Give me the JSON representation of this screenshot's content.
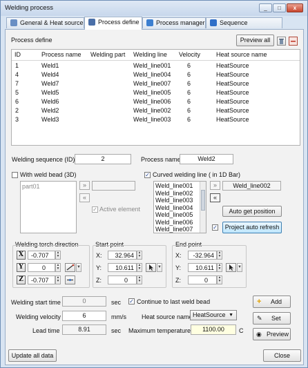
{
  "window": {
    "title": "Welding process",
    "controls": [
      "_",
      "□",
      "x"
    ]
  },
  "tabs": [
    {
      "label": "General & Heat source",
      "active": false
    },
    {
      "label": "Process define",
      "active": true
    },
    {
      "label": "Process manager",
      "active": false
    },
    {
      "label": "Sequence optimization",
      "active": false
    }
  ],
  "process_define": {
    "section_label": "Process define",
    "preview_all_label": "Preview all",
    "delete_icon": "trash-icon",
    "remove_icon": "minus-icon",
    "columns": [
      "ID",
      "Process name",
      "Welding part",
      "Welding line",
      "Velocity",
      "Heat source name"
    ],
    "rows": [
      [
        "1",
        "Weld1",
        "",
        "Weld_line001",
        "6",
        "HeatSource"
      ],
      [
        "4",
        "Weld4",
        "",
        "Weld_line004",
        "6",
        "HeatSource"
      ],
      [
        "7",
        "Weld7",
        "",
        "Weld_line007",
        "6",
        "HeatSource"
      ],
      [
        "5",
        "Weld5",
        "",
        "Weld_line005",
        "6",
        "HeatSource"
      ],
      [
        "6",
        "Weld6",
        "",
        "Weld_line006",
        "6",
        "HeatSource"
      ],
      [
        "2",
        "Weld2",
        "",
        "Weld_line002",
        "6",
        "HeatSource"
      ],
      [
        "3",
        "Weld3",
        "",
        "Weld_line003",
        "6",
        "HeatSource"
      ]
    ]
  },
  "sequence": {
    "seq_label": "Welding sequence (ID):",
    "seq_value": "2",
    "name_label": "Process name:",
    "name_value": "Weld2"
  },
  "weld_bead": {
    "checkbox_label": "With weld bead (3D)",
    "checked": false,
    "parts": [
      "part01"
    ],
    "add_arrow": "»",
    "remove_arrow": "«",
    "active_label": "Active element",
    "active_checked": true
  },
  "curved_line": {
    "checkbox_label": "Curved welding line ( in 1D Bar)",
    "checked": true,
    "lines": [
      "Weld_line001",
      "Weld_line002",
      "Weld_line003",
      "Weld_line004",
      "Weld_line005",
      "Weld_line006",
      "Weld_line007"
    ],
    "add_arrow": "»",
    "remove_arrow": "«",
    "selected_line": "Weld_line002",
    "auto_get_label": "Auto get position",
    "project_refresh_label": "Project auto refresh",
    "project_refresh_checked": true
  },
  "torch": {
    "title": "Welding torch direction",
    "x_label": "X",
    "x": "-0.707",
    "y_label": "Y",
    "y": "0",
    "z_label": "Z",
    "z": "-0.707"
  },
  "start_point": {
    "title": "Start point",
    "x_label": "X:",
    "x": "32.964",
    "y_label": "Y:",
    "y": "10.611",
    "z_label": "Z:",
    "z": "0"
  },
  "end_point": {
    "title": "End point",
    "x_label": "X:",
    "x": "-32.964",
    "y_label": "Y:",
    "y": "10.611",
    "z_label": "Z:",
    "z": "0"
  },
  "params": {
    "start_time_label": "Welding start time",
    "start_time": "0",
    "start_time_unit": "sec",
    "continue_label": "Continue to last weld bead",
    "continue_checked": true,
    "velocity_label": "Welding velocity",
    "velocity": "6",
    "velocity_unit": "mm/s",
    "heat_source_label": "Heat source name",
    "heat_source": "HeatSource",
    "lead_time_label": "Lead time",
    "lead_time": "8.91",
    "lead_time_unit": "sec",
    "max_temp_label": "Maximum temperature",
    "max_temp": "1100.00",
    "max_temp_unit": "C"
  },
  "actions": {
    "add": "Add",
    "set": "Set",
    "preview": "Preview"
  },
  "footer": {
    "update_all": "Update all data",
    "close": "Close"
  },
  "colors": {
    "accent_blue": "#3c7fb1",
    "title_bar": "#c7d7ec",
    "highlight_field": "#ffffe1"
  }
}
